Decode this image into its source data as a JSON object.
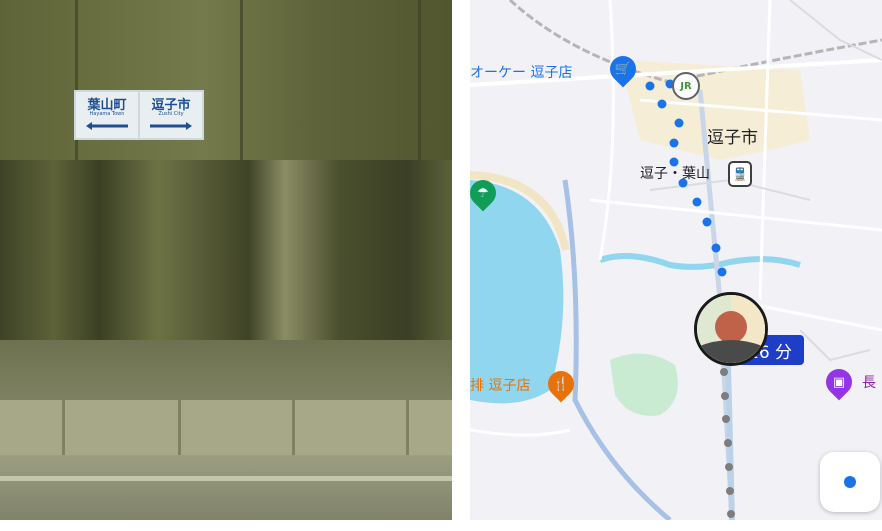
{
  "photo": {
    "sign_left": {
      "main": "葉山町",
      "sub": "Hayama Town"
    },
    "sign_right": {
      "main": "逗子市",
      "sub": "Zushi City"
    }
  },
  "map": {
    "poi_shop_label": "オーケー 逗子店",
    "city_label": "逗子市",
    "station_label": "逗子・葉山",
    "jr_badge": "JR",
    "restaurant_label": "逗子店",
    "restaurant_partial": "排",
    "purple_label": "長",
    "duration": "16 分",
    "icons": {
      "shop": "shopping-cart-icon",
      "beach": "beach-umbrella-icon",
      "restaurant": "fork-knife-icon",
      "purple": "place-icon",
      "train": "train-icon",
      "locate": "my-location-icon"
    },
    "colors": {
      "route_dots": "#1a73e8",
      "route_dots_future": "#8a8a8a",
      "duration_badge": "#1e3ec8",
      "water": "#8fd6ee"
    }
  }
}
